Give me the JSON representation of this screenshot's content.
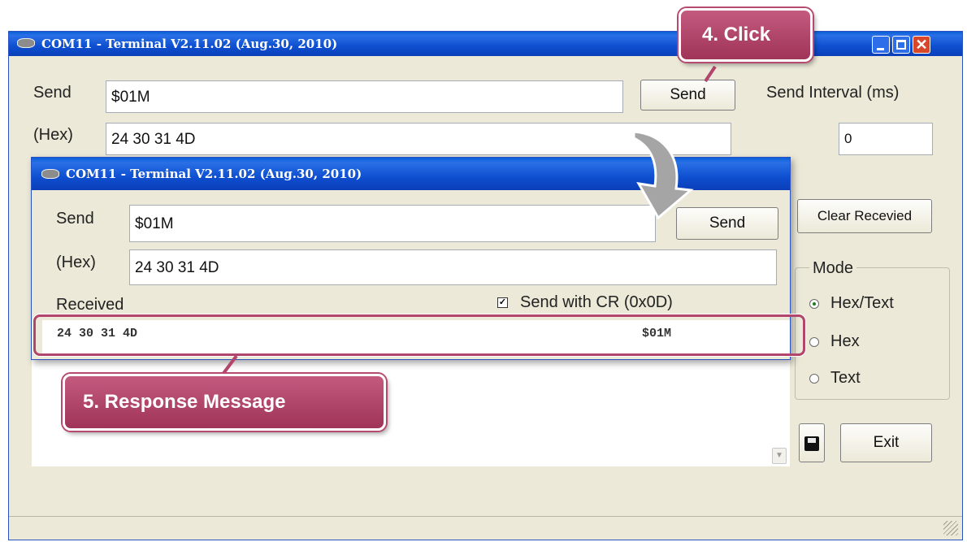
{
  "back_window": {
    "title": "COM11 - Terminal V2.11.02 (Aug.30, 2010)",
    "send_label": "Send",
    "send_value": "$01M",
    "hex_label": "(Hex)",
    "hex_value": "24 30 31 4D",
    "send_button": "Send",
    "interval_label": "Send Interval (ms)",
    "interval_value": "0",
    "clear_button": "Clear Recevied",
    "mode_label": "Mode",
    "mode_options": [
      "Hex/Text",
      "Hex",
      "Text"
    ],
    "mode_selected": "Hex/Text",
    "exit_button": "Exit"
  },
  "front_window": {
    "title": "COM11 - Terminal V2.11.02 (Aug.30, 2010)",
    "send_label": "Send",
    "send_value": "$01M",
    "hex_label": "(Hex)",
    "hex_value": "24 30 31 4D",
    "send_button": "Send",
    "received_label": "Received",
    "cr_label": "Send with CR (0x0D)",
    "cr_checked": true,
    "received_hex": "24 30 31 4D",
    "received_text": "$01M"
  },
  "callouts": {
    "click": "4. Click",
    "response": "5. Response Message"
  },
  "colors": {
    "titlebar": "#0b4fd0",
    "callout": "#a93a61",
    "highlight_border": "#b2456c",
    "window_bg": "#ece9d8"
  }
}
